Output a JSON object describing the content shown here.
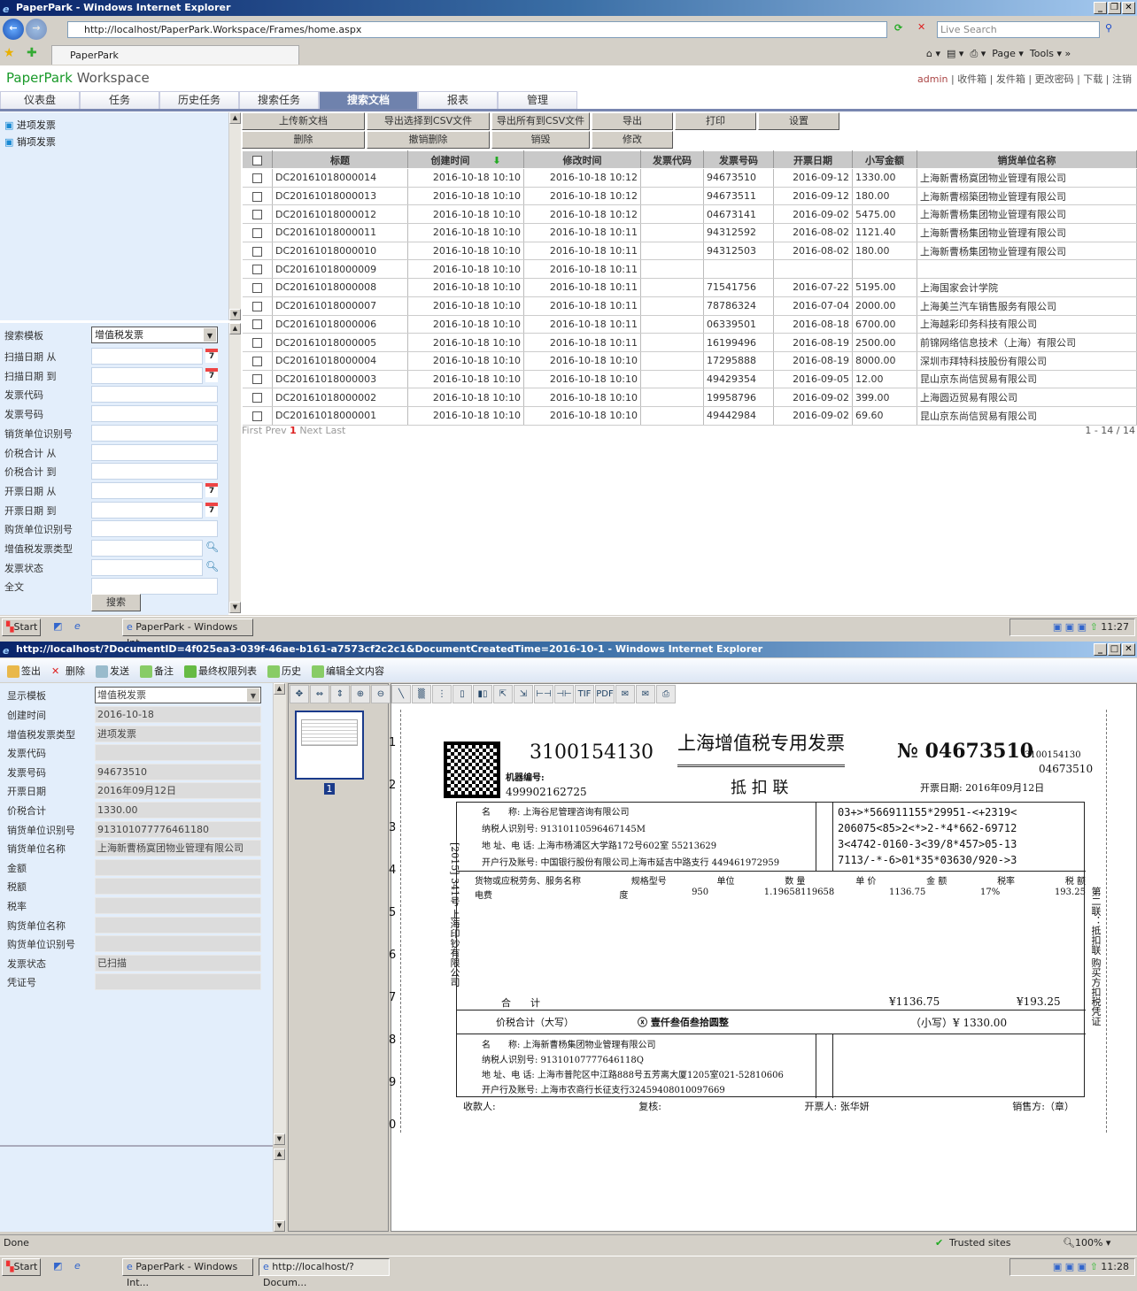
{
  "window1": {
    "title": "PaperPark - Windows Internet Explorer",
    "address": "http://localhost/PaperPark.Workspace/Frames/home.aspx",
    "search_placeholder": "Live Search",
    "tab": "PaperPark",
    "cmd": {
      "page": "Page",
      "tools": "Tools"
    }
  },
  "app": {
    "brand": "PaperPark",
    "brand2": "Workspace",
    "user": "admin",
    "links": [
      "收件箱",
      "发件箱",
      "更改密码",
      "下载",
      "注销"
    ],
    "nav": [
      "仪表盘",
      "任务",
      "历史任务",
      "搜索任务",
      "搜索文档",
      "报表",
      "管理"
    ],
    "active_nav": "搜索文档",
    "tree": [
      "进项发票",
      "销项发票"
    ],
    "toolbar_row1": [
      "上传新文档",
      "导出选择到CSV文件",
      "导出所有到CSV文件",
      "导出",
      "打印",
      "设置"
    ],
    "toolbar_row2": [
      "删除",
      "撤销删除",
      "销毁",
      "修改"
    ]
  },
  "search": {
    "template_label": "搜索模板",
    "template_value": "增值税发票",
    "fields": [
      {
        "label": "扫描日期 从",
        "icon": "calendar"
      },
      {
        "label": "扫描日期 到",
        "icon": "calendar"
      },
      {
        "label": "发票代码"
      },
      {
        "label": "发票号码"
      },
      {
        "label": "销货单位识别号"
      },
      {
        "label": "价税合计 从"
      },
      {
        "label": "价税合计 到"
      },
      {
        "label": "开票日期 从",
        "icon": "calendar"
      },
      {
        "label": "开票日期 到",
        "icon": "calendar"
      },
      {
        "label": "购货单位识别号"
      },
      {
        "label": "增值税发票类型",
        "icon": "lookup"
      },
      {
        "label": "发票状态",
        "icon": "lookup"
      },
      {
        "label": "全文"
      }
    ],
    "button": "搜索"
  },
  "table": {
    "columns": [
      "标题",
      "创建时间",
      "修改时间",
      "发票代码",
      "发票号码",
      "开票日期",
      "小写金额",
      "销货单位名称"
    ],
    "sort_column": "创建时间",
    "sort_icon": "arrow-down-icon",
    "rows": [
      [
        "DC20161018000014",
        "2016-10-18 10:10",
        "2016-10-18 10:12",
        "",
        "94673510",
        "2016-09-12",
        "1330.00",
        "上海新曹杨寞团物业管理有限公司"
      ],
      [
        "DC20161018000013",
        "2016-10-18 10:10",
        "2016-10-18 10:12",
        "",
        "94673511",
        "2016-09-12",
        "180.00",
        "上海新曹榒築团物业管理有限公司"
      ],
      [
        "DC20161018000012",
        "2016-10-18 10:10",
        "2016-10-18 10:12",
        "",
        "04673141",
        "2016-09-02",
        "5475.00",
        "上海新曹杨集团物业管理有限公司"
      ],
      [
        "DC20161018000011",
        "2016-10-18 10:10",
        "2016-10-18 10:11",
        "",
        "94312592",
        "2016-08-02",
        "1121.40",
        "上海新曹杨集团物业管理有限公司"
      ],
      [
        "DC20161018000010",
        "2016-10-18 10:10",
        "2016-10-18 10:11",
        "",
        "94312503",
        "2016-08-02",
        "180.00",
        "上海新曹杨集团物业管理有限公司"
      ],
      [
        "DC20161018000009",
        "2016-10-18 10:10",
        "2016-10-18 10:11",
        "",
        "",
        "",
        "",
        ""
      ],
      [
        "DC20161018000008",
        "2016-10-18 10:10",
        "2016-10-18 10:11",
        "",
        "71541756",
        "2016-07-22",
        "5195.00",
        "上海国家会计学院"
      ],
      [
        "DC20161018000007",
        "2016-10-18 10:10",
        "2016-10-18 10:11",
        "",
        "78786324",
        "2016-07-04",
        "2000.00",
        "上海美兰汽车销售服务有限公司"
      ],
      [
        "DC20161018000006",
        "2016-10-18 10:10",
        "2016-10-18 10:11",
        "",
        "06339501",
        "2016-08-18",
        "6700.00",
        "上海越彩印务科技有限公司"
      ],
      [
        "DC20161018000005",
        "2016-10-18 10:10",
        "2016-10-18 10:11",
        "",
        "16199496",
        "2016-08-19",
        "2500.00",
        "前锦网络信息技术（上海）有限公司"
      ],
      [
        "DC20161018000004",
        "2016-10-18 10:10",
        "2016-10-18 10:10",
        "",
        "17295888",
        "2016-08-19",
        "8000.00",
        "深圳市拜特科技股份有限公司"
      ],
      [
        "DC20161018000003",
        "2016-10-18 10:10",
        "2016-10-18 10:10",
        "",
        "49429354",
        "2016-09-05",
        "12.00",
        "昆山京东尚信贸易有限公司"
      ],
      [
        "DC20161018000002",
        "2016-10-18 10:10",
        "2016-10-18 10:10",
        "",
        "19958796",
        "2016-09-02",
        "399.00",
        "上海圆迈贸易有限公司"
      ],
      [
        "DC20161018000001",
        "2016-10-18 10:10",
        "2016-10-18 10:10",
        "",
        "49442984",
        "2016-09-02",
        "69.60",
        "昆山京东尚信贸易有限公司"
      ]
    ],
    "pager": {
      "first": "First",
      "prev": "Prev",
      "current": "1",
      "next": "Next",
      "last": "Last",
      "range": "1 - 14 / 14"
    }
  },
  "taskbar1": {
    "start": "Start",
    "item": "PaperPark - Windows Int...",
    "clock": "11:27"
  },
  "window2": {
    "title": "http://localhost/?DocumentID=4f025ea3-039f-46ae-b161-a7573cf2c2c1&DocumentCreatedTime=2016-10-1 - Windows Internet Explorer",
    "toolbar": [
      "签出",
      "删除",
      "发送",
      "备注",
      "最终权限列表",
      "历史",
      "编辑全文内容"
    ],
    "template_label": "显示模板",
    "template_value": "增值税发票",
    "fields": [
      [
        "创建时间",
        "2016-10-18"
      ],
      [
        "增值税发票类型",
        "进项发票"
      ],
      [
        "发票代码",
        ""
      ],
      [
        "发票号码",
        "94673510"
      ],
      [
        "开票日期",
        "2016年09月12日"
      ],
      [
        "价税合计",
        "1330.00"
      ],
      [
        "销货单位识别号",
        "913101077776461180"
      ],
      [
        "销货单位名称",
        "上海新曹杨寞团物业管理有限公司"
      ],
      [
        "金额",
        ""
      ],
      [
        "税额",
        ""
      ],
      [
        "税率",
        ""
      ],
      [
        "购货单位名称",
        ""
      ],
      [
        "购货单位识别号",
        ""
      ],
      [
        "发票状态",
        "已扫描"
      ],
      [
        "凭证号",
        ""
      ]
    ],
    "thumbnail_page": "1",
    "status": "Done",
    "zone": "Trusted sites",
    "zoom": "100%"
  },
  "invoice": {
    "code": "3100154130",
    "title": "上海增值税专用发票",
    "no_label": "№",
    "number": "04673510",
    "side_code": "3100154130",
    "side_number": "04673510",
    "copy": "抵 扣 联",
    "machine_label": "机器编号:",
    "machine_no": "499902162725",
    "date_label": "开票日期:",
    "date": "2016年09月12日",
    "buyer": {
      "name": "名　　称: 上海谷尼管理咨询有限公司",
      "tax_id": "纳税人识别号: 91310110596467145M",
      "addr": "地 址、电 话: 上海市杨浦区大学路172号602室 55213629",
      "bank": "开户行及账号: 中国银行股份有限公司上海市延吉中路支行 449461972959"
    },
    "cipher": [
      "03+>*566911155*29951-<+2319<",
      "206075<85>2<*>2-*4*662-69712",
      "3<4742-0160-3<39/8*457>05-13",
      "7113/-*-6>01*35*03630/920->3"
    ],
    "headers": [
      "货物或应税劳务、服务名称",
      "规格型号",
      "单位",
      "数 量",
      "单 价",
      "金 额",
      "税率",
      "税 额"
    ],
    "item": [
      "电费",
      "",
      "度",
      "950",
      "1.19658119658",
      "1136.75",
      "17%",
      "193.25"
    ],
    "total_label": "合　　计",
    "total_amount": "¥1136.75",
    "total_tax": "¥193.25",
    "grand_label": "价税合计（大写）",
    "grand_words": "ⓧ 壹仟叁佰叁拾圆整",
    "grand_small": "（小写）¥ 1330.00",
    "seller": {
      "name": "名　　称: 上海新曹杨集团物业管理有限公司",
      "tax_id": "纳税人识别号: 91310107777646118Q",
      "addr": "地 址、电 话: 上海市普陀区中江路888号五芳离大厦1205室021-52810606",
      "bank": "开户行及账号: 上海市农商行长征支行32459408010097669"
    },
    "footer": [
      "收款人:",
      "复核:",
      "开票人: 张华妍",
      "销售方:（章）"
    ],
    "side_text": "第二联：抵扣联 购买方扣税凭证",
    "printer_text": "[2015] 341号 上海印钞有限公司",
    "margin_numbers": [
      "1",
      "2",
      "3",
      "4",
      "5",
      "6",
      "7",
      "8",
      "9",
      "0"
    ]
  },
  "taskbar2": {
    "start": "Start",
    "item1": "PaperPark - Windows Int...",
    "item2": "http://localhost/?Docum...",
    "clock": "11:28"
  }
}
